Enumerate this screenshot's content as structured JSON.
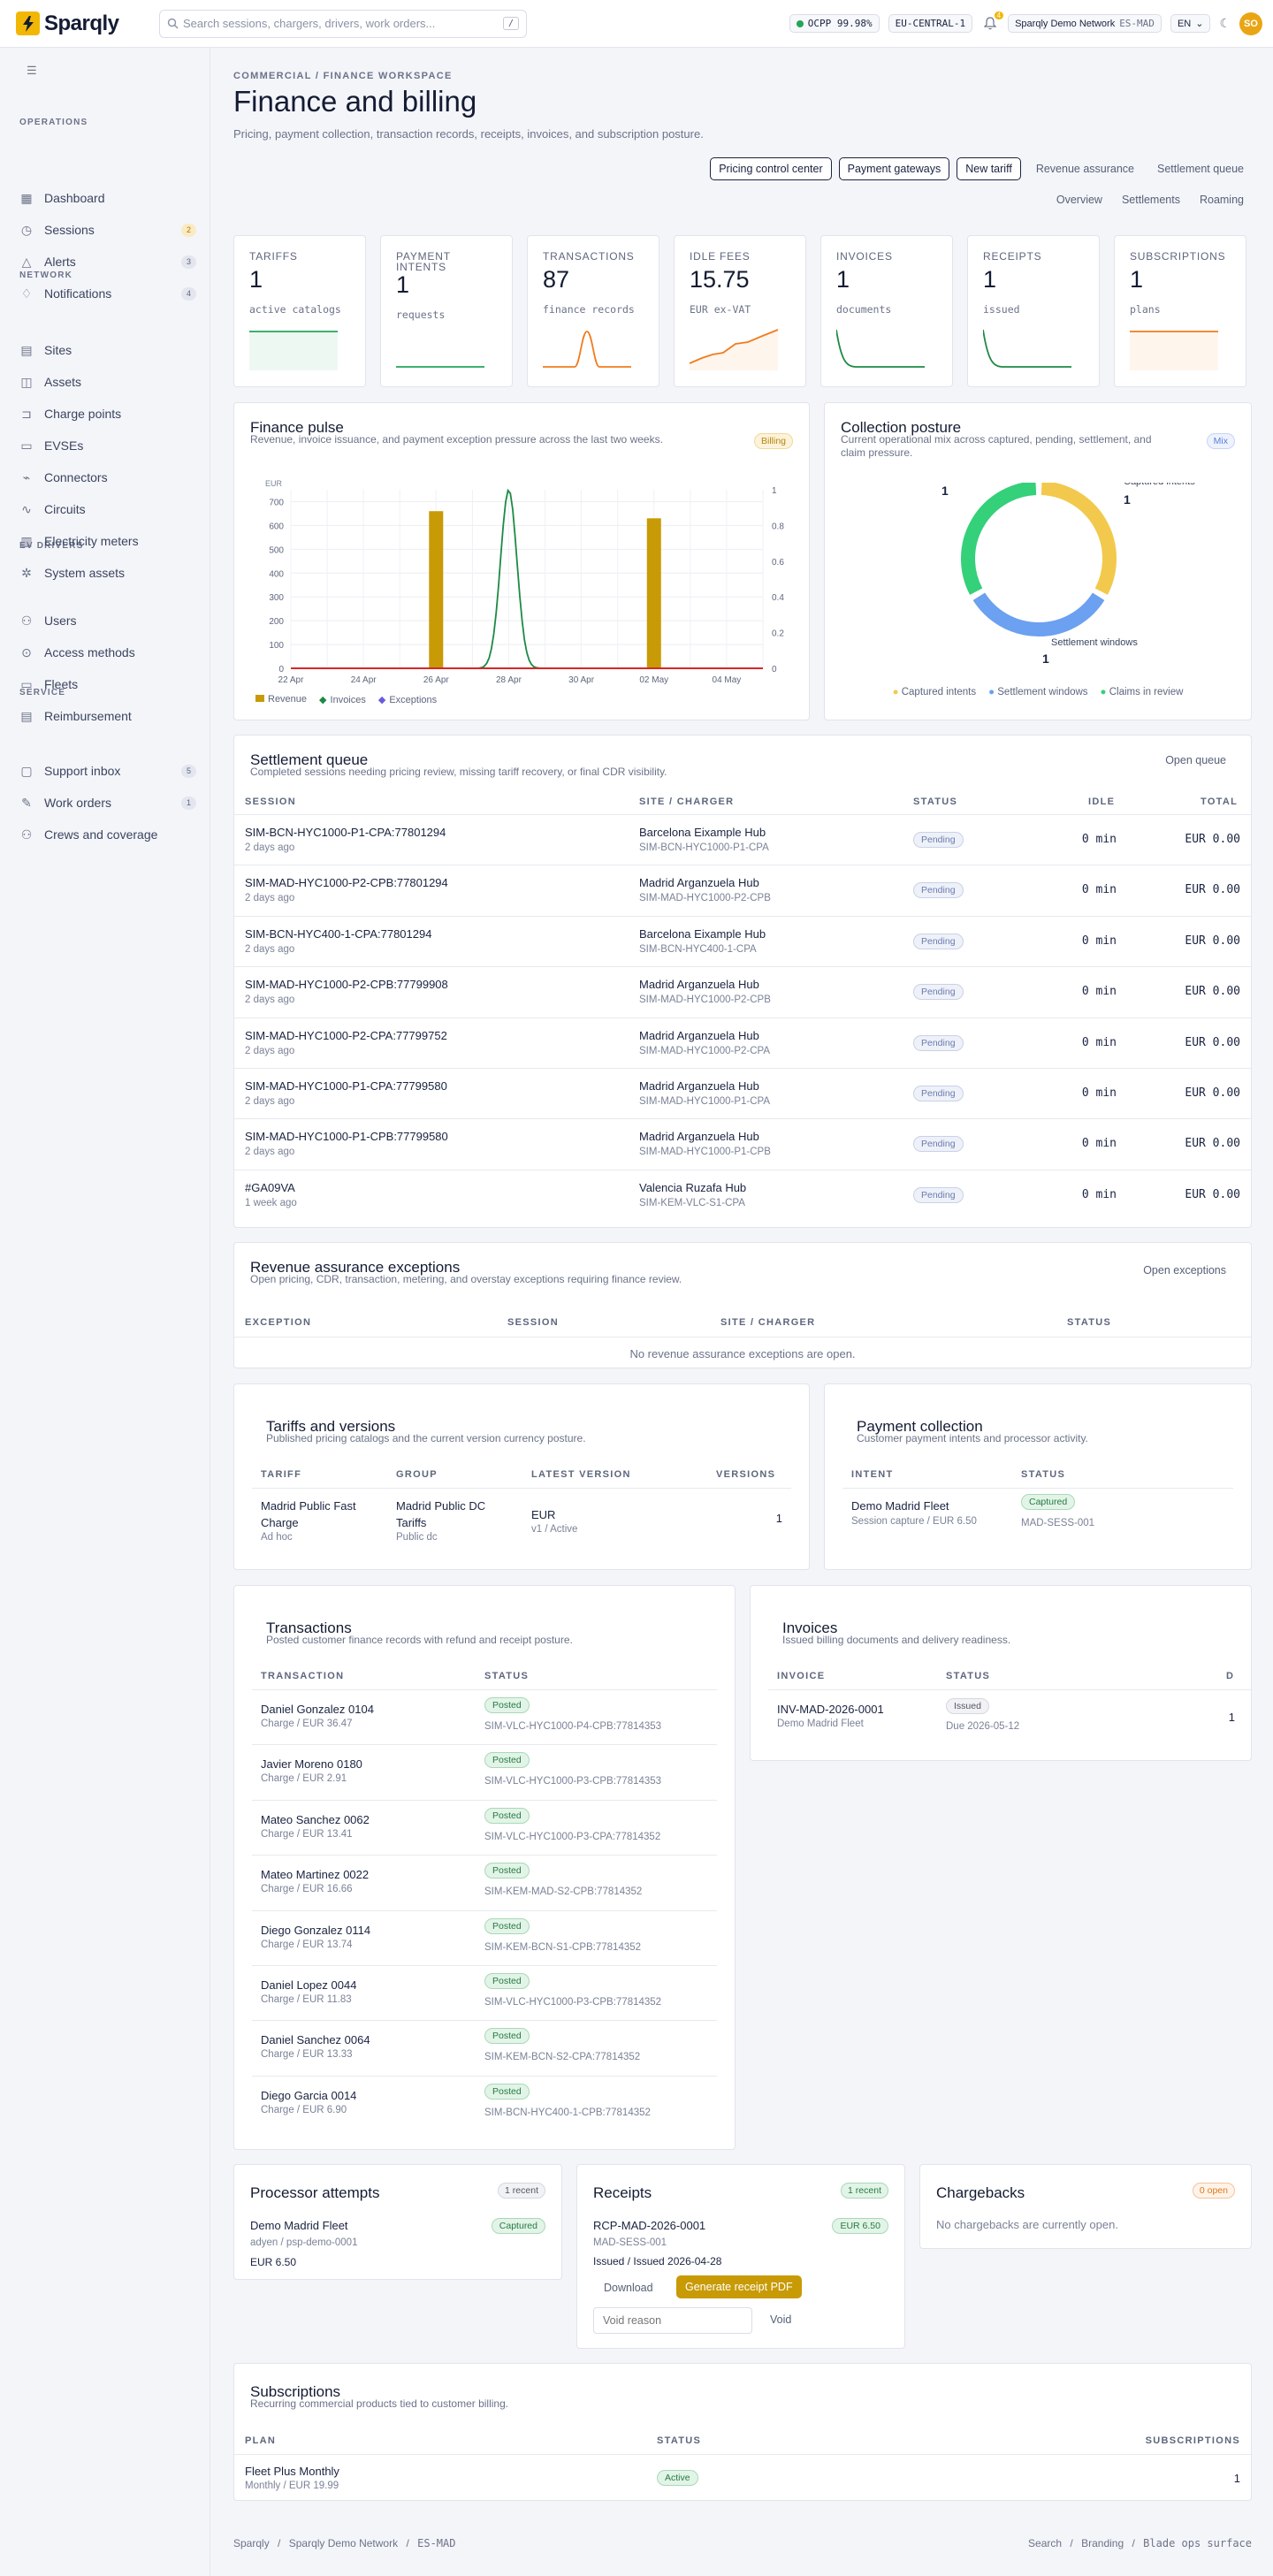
{
  "topbar": {
    "logo": "Sparqly",
    "search_placeholder": "Search sessions, chargers, drivers, work orders...",
    "search_key": "/",
    "ocpp": "OCPP 99.98%",
    "region": "EU-CENTRAL-1",
    "notif_count": "4",
    "network": "Sparqly Demo Network",
    "network_code": "ES-MAD",
    "lang": "EN",
    "avatar": "SO"
  },
  "sidebar": {
    "sections": [
      "OPERATIONS",
      "NETWORK",
      "EV DRIVERS",
      "SERVICE"
    ],
    "items": [
      {
        "label": "Dashboard",
        "icon": "grid-icon",
        "count": ""
      },
      {
        "label": "Sessions",
        "icon": "clock-icon",
        "count": "2",
        "tone": "amber"
      },
      {
        "label": "Alerts",
        "icon": "warning-icon",
        "count": "3",
        "tone": "gray"
      },
      {
        "label": "Notifications",
        "icon": "bell-icon",
        "count": "4",
        "tone": "gray"
      },
      {
        "label": "Sites",
        "icon": "building-icon",
        "count": ""
      },
      {
        "label": "Assets",
        "icon": "box-icon",
        "count": ""
      },
      {
        "label": "Charge points",
        "icon": "plug-icon",
        "count": ""
      },
      {
        "label": "EVSEs",
        "icon": "battery-icon",
        "count": ""
      },
      {
        "label": "Connectors",
        "icon": "connector-icon",
        "count": ""
      },
      {
        "label": "Circuits",
        "icon": "circuit-icon",
        "count": ""
      },
      {
        "label": "Electricity meters",
        "icon": "meter-icon",
        "count": ""
      },
      {
        "label": "System assets",
        "icon": "gear-icon",
        "count": ""
      },
      {
        "label": "Users",
        "icon": "users-icon",
        "count": ""
      },
      {
        "label": "Access methods",
        "icon": "key-icon",
        "count": ""
      },
      {
        "label": "Fleets",
        "icon": "car-icon",
        "count": ""
      },
      {
        "label": "Reimbursement",
        "icon": "receipt-icon",
        "count": ""
      },
      {
        "label": "Support inbox",
        "icon": "inbox-icon",
        "count": "5",
        "tone": "gray"
      },
      {
        "label": "Work orders",
        "icon": "wrench-icon",
        "count": "1",
        "tone": "gray"
      },
      {
        "label": "Crews and coverage",
        "icon": "crew-icon",
        "count": ""
      }
    ]
  },
  "header": {
    "breadcrumb": "COMMERCIAL / FINANCE WORKSPACE",
    "title": "Finance and billing",
    "subtitle": "Pricing, payment collection, transaction records, receipts, invoices, and subscription posture.",
    "buttons": [
      "Pricing control center",
      "Payment gateways",
      "New tariff"
    ],
    "links": [
      "Revenue assurance",
      "Settlement queue"
    ],
    "links2": [
      "Overview",
      "Settlements",
      "Roaming"
    ]
  },
  "stats": [
    {
      "label": "TARIFFS",
      "value": "1",
      "sub": "active catalogs",
      "color": "#22a55a"
    },
    {
      "label": "PAYMENT INTENTS",
      "value": "1",
      "sub": "requests",
      "color": "#22a55a"
    },
    {
      "label": "TRANSACTIONS",
      "value": "87",
      "sub": "finance records",
      "color": "#f07c1e"
    },
    {
      "label": "IDLE FEES",
      "value": "15.75",
      "sub": "EUR ex-VAT",
      "color": "#f07c1e"
    },
    {
      "label": "INVOICES",
      "value": "1",
      "sub": "documents",
      "color": "#1d8a44"
    },
    {
      "label": "RECEIPTS",
      "value": "1",
      "sub": "issued",
      "color": "#1d8a44"
    },
    {
      "label": "SUBSCRIPTIONS",
      "value": "1",
      "sub": "plans",
      "color": "#f07c1e"
    }
  ],
  "pulse": {
    "title": "Finance pulse",
    "subtitle": "Revenue, invoice issuance, and payment exception pressure across the last two weeks.",
    "tag": "Billing",
    "legend": [
      "Revenue",
      "Invoices",
      "Exceptions"
    ],
    "chart_data": {
      "type": "bar",
      "x": [
        "22 Apr",
        "23 Apr",
        "24 Apr",
        "25 Apr",
        "26 Apr",
        "27 Apr",
        "28 Apr",
        "29 Apr",
        "30 Apr",
        "01 May",
        "02 May",
        "03 May",
        "04 May",
        "05 May"
      ],
      "xticks": [
        "22 Apr",
        "24 Apr",
        "26 Apr",
        "28 Apr",
        "30 Apr",
        "02 May",
        "04 May"
      ],
      "y_left_ticks": [
        "0",
        "100",
        "200",
        "300",
        "400",
        "500",
        "600",
        "700"
      ],
      "y_left_unit": "EUR",
      "y_right_ticks": [
        "0",
        "0.2",
        "0.4",
        "0.6",
        "0.8",
        "1"
      ],
      "ylim_left": [
        0,
        750
      ],
      "ylim_right": [
        0,
        1
      ],
      "series": [
        {
          "name": "Revenue",
          "type": "bar",
          "color": "#c89a06",
          "values": [
            0,
            0,
            0,
            0,
            660,
            0,
            0,
            0,
            0,
            0,
            630,
            0,
            0,
            0
          ]
        },
        {
          "name": "Invoices",
          "type": "line",
          "color": "#1d8a44",
          "values": [
            0,
            0,
            0,
            0,
            0,
            0,
            1,
            0,
            0,
            0,
            0,
            0,
            0,
            0
          ]
        },
        {
          "name": "Exceptions",
          "type": "line",
          "color": "#d62828",
          "values": [
            0,
            0,
            0,
            0,
            0,
            0,
            0,
            0,
            0,
            0,
            0,
            0,
            0,
            0
          ]
        }
      ]
    }
  },
  "collection": {
    "title": "Collection posture",
    "subtitle": "Current operational mix across captured, pending, settlement, and claim pressure.",
    "tag": "Mix",
    "chart_data": {
      "type": "pie",
      "labels": [
        "Captured intents",
        "Settlement windows",
        "Claims in review"
      ],
      "values": [
        1,
        1,
        1
      ],
      "colors": [
        "#f2c94c",
        "#6ca0f0",
        "#34d07a"
      ]
    }
  },
  "settlement": {
    "title": "Settlement queue",
    "subtitle": "Completed sessions needing pricing review, missing tariff recovery, or final CDR visibility.",
    "action": "Open queue",
    "headers": [
      "SESSION",
      "SITE / CHARGER",
      "STATUS",
      "IDLE",
      "TOTAL"
    ],
    "rows": [
      {
        "session": "SIM-BCN-HYC1000-P1-CPA:77801294",
        "ago": "2 days ago",
        "site": "Barcelona Eixample Hub",
        "charger": "SIM-BCN-HYC1000-P1-CPA",
        "status": "Pending",
        "idle": "0 min",
        "total": "EUR 0.00"
      },
      {
        "session": "SIM-MAD-HYC1000-P2-CPB:77801294",
        "ago": "2 days ago",
        "site": "Madrid Arganzuela Hub",
        "charger": "SIM-MAD-HYC1000-P2-CPB",
        "status": "Pending",
        "idle": "0 min",
        "total": "EUR 0.00"
      },
      {
        "session": "SIM-BCN-HYC400-1-CPA:77801294",
        "ago": "2 days ago",
        "site": "Barcelona Eixample Hub",
        "charger": "SIM-BCN-HYC400-1-CPA",
        "status": "Pending",
        "idle": "0 min",
        "total": "EUR 0.00"
      },
      {
        "session": "SIM-MAD-HYC1000-P2-CPB:77799908",
        "ago": "2 days ago",
        "site": "Madrid Arganzuela Hub",
        "charger": "SIM-MAD-HYC1000-P2-CPB",
        "status": "Pending",
        "idle": "0 min",
        "total": "EUR 0.00"
      },
      {
        "session": "SIM-MAD-HYC1000-P2-CPA:77799752",
        "ago": "2 days ago",
        "site": "Madrid Arganzuela Hub",
        "charger": "SIM-MAD-HYC1000-P2-CPA",
        "status": "Pending",
        "idle": "0 min",
        "total": "EUR 0.00"
      },
      {
        "session": "SIM-MAD-HYC1000-P1-CPA:77799580",
        "ago": "2 days ago",
        "site": "Madrid Arganzuela Hub",
        "charger": "SIM-MAD-HYC1000-P1-CPA",
        "status": "Pending",
        "idle": "0 min",
        "total": "EUR 0.00"
      },
      {
        "session": "SIM-MAD-HYC1000-P1-CPB:77799580",
        "ago": "2 days ago",
        "site": "Madrid Arganzuela Hub",
        "charger": "SIM-MAD-HYC1000-P1-CPB",
        "status": "Pending",
        "idle": "0 min",
        "total": "EUR 0.00"
      },
      {
        "session": "#GA09VA",
        "ago": "1 week ago",
        "site": "Valencia Ruzafa Hub",
        "charger": "SIM-KEM-VLC-S1-CPA",
        "status": "Pending",
        "idle": "0 min",
        "total": "EUR 0.00"
      }
    ]
  },
  "revenue": {
    "title": "Revenue assurance exceptions",
    "subtitle": "Open pricing, CDR, transaction, metering, and overstay exceptions requiring finance review.",
    "action": "Open exceptions",
    "headers": [
      "EXCEPTION",
      "SESSION",
      "SITE / CHARGER",
      "STATUS"
    ],
    "empty": "No revenue assurance exceptions are open."
  },
  "tariffs": {
    "title": "Tariffs and versions",
    "subtitle": "Published pricing catalogs and the current version currency posture.",
    "headers": [
      "TARIFF",
      "GROUP",
      "LATEST VERSION",
      "VERSIONS"
    ],
    "row": {
      "tariff_line1": "Madrid Public Fast",
      "tariff_line2": "Charge",
      "tariff_sub": "Ad hoc",
      "group_line1": "Madrid Public DC",
      "group_line2": "Tariffs",
      "group_sub": "Public dc",
      "version": "EUR",
      "version_sub": "v1 / Active",
      "versions": "1"
    }
  },
  "payment": {
    "title": "Payment collection",
    "subtitle": "Customer payment intents and processor activity.",
    "headers": [
      "INTENT",
      "STATUS"
    ],
    "row": {
      "intent": "Demo Madrid Fleet",
      "intent_sub": "Session capture / EUR 6.50",
      "status": "Captured",
      "status_sub": "MAD-SESS-001"
    }
  },
  "transactions": {
    "title": "Transactions",
    "subtitle": "Posted customer finance records with refund and receipt posture.",
    "headers": [
      "TRANSACTION",
      "STATUS"
    ],
    "rows": [
      {
        "name": "Daniel Gonzalez 0104",
        "sub": "Charge / EUR 36.47",
        "status": "Posted",
        "ref": "SIM-VLC-HYC1000-P4-CPB:77814353"
      },
      {
        "name": "Javier Moreno 0180",
        "sub": "Charge / EUR 2.91",
        "status": "Posted",
        "ref": "SIM-VLC-HYC1000-P3-CPB:77814353"
      },
      {
        "name": "Mateo Sanchez 0062",
        "sub": "Charge / EUR 13.41",
        "status": "Posted",
        "ref": "SIM-VLC-HYC1000-P3-CPA:77814352"
      },
      {
        "name": "Mateo Martinez 0022",
        "sub": "Charge / EUR 16.66",
        "status": "Posted",
        "ref": "SIM-KEM-MAD-S2-CPB:77814352"
      },
      {
        "name": "Diego Gonzalez 0114",
        "sub": "Charge / EUR 13.74",
        "status": "Posted",
        "ref": "SIM-KEM-BCN-S1-CPB:77814352"
      },
      {
        "name": "Daniel Lopez 0044",
        "sub": "Charge / EUR 11.83",
        "status": "Posted",
        "ref": "SIM-VLC-HYC1000-P3-CPB:77814352"
      },
      {
        "name": "Daniel Sanchez 0064",
        "sub": "Charge / EUR 13.33",
        "status": "Posted",
        "ref": "SIM-KEM-BCN-S2-CPA:77814352"
      },
      {
        "name": "Diego Garcia 0014",
        "sub": "Charge / EUR 6.90",
        "status": "Posted",
        "ref": "SIM-BCN-HYC400-1-CPB:77814352"
      }
    ]
  },
  "invoices": {
    "title": "Invoices",
    "subtitle": "Issued billing documents and delivery readiness.",
    "headers": [
      "INVOICE",
      "STATUS",
      "D"
    ],
    "row": {
      "invoice": "INV-MAD-2026-0001",
      "invoice_sub": "Demo Madrid Fleet",
      "status": "Issued",
      "status_sub": "Due 2026-05-12",
      "count": "1"
    }
  },
  "processor": {
    "title": "Processor attempts",
    "tag": "1 recent",
    "name": "Demo Madrid Fleet",
    "status": "Captured",
    "provider": "adyen / psp-demo-0001",
    "amount": "EUR 6.50"
  },
  "receipts": {
    "title": "Receipts",
    "tag": "1 recent",
    "number": "RCP-MAD-2026-0001",
    "amount": "EUR 6.50",
    "session": "MAD-SESS-001",
    "issued": "Issued / Issued 2026-04-28",
    "download": "Download",
    "generate": "Generate receipt PDF",
    "void_placeholder": "Void reason",
    "void": "Void"
  },
  "chargebacks": {
    "title": "Chargebacks",
    "tag": "0 open",
    "empty": "No chargebacks are currently open."
  },
  "subscriptions": {
    "title": "Subscriptions",
    "subtitle": "Recurring commercial products tied to customer billing.",
    "headers": [
      "PLAN",
      "STATUS",
      "SUBSCRIPTIONS"
    ],
    "row": {
      "plan": "Fleet Plus Monthly",
      "plan_sub": "Monthly / EUR 19.99",
      "status": "Active",
      "count": "1"
    }
  },
  "footer": {
    "left": [
      "Sparqly",
      "Sparqly Demo Network",
      "ES-MAD"
    ],
    "right": [
      "Search",
      "Branding",
      "Blade ops surface"
    ]
  }
}
